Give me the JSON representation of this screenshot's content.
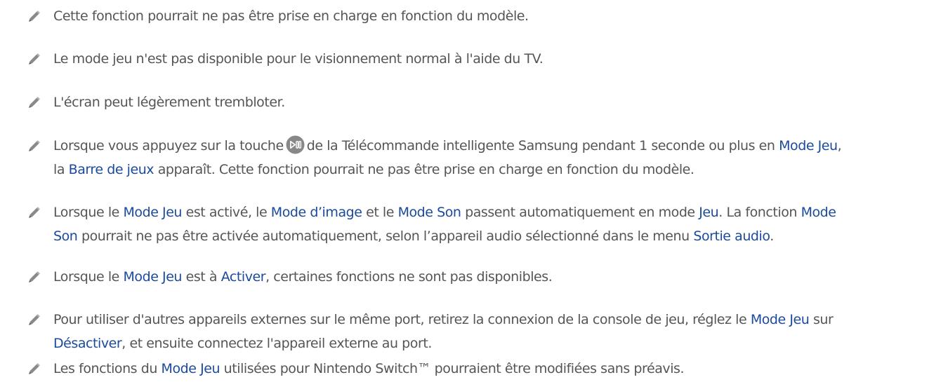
{
  "notes": [
    {
      "lines": [
        [
          {
            "t": "Cette fonction pourrait ne pas être prise en charge en fonction du modèle."
          }
        ]
      ]
    },
    {
      "lines": [
        [
          {
            "t": "Le mode jeu n'est pas disponible pour le visionnement normal à l'aide du TV."
          }
        ]
      ]
    },
    {
      "lines": [
        [
          {
            "t": "L'écran peut légèrement trembloter."
          }
        ]
      ]
    },
    {
      "lines": [
        [
          {
            "t": "Lorsque vous appuyez sur la touche"
          },
          {
            "icon": "play-pause-icon"
          },
          {
            "t": "de la Télécommande intelligente Samsung pendant 1 seconde ou plus en "
          },
          {
            "t": "Mode Jeu",
            "hl": true
          },
          {
            "t": ","
          }
        ],
        [
          {
            "t": "la "
          },
          {
            "t": "Barre de jeux",
            "hl": true
          },
          {
            "t": " apparaît. Cette fonction pourrait ne pas être prise en charge en fonction du modèle."
          }
        ]
      ]
    },
    {
      "lines": [
        [
          {
            "t": "Lorsque le "
          },
          {
            "t": "Mode Jeu",
            "hl": true
          },
          {
            "t": " est activé, le "
          },
          {
            "t": "Mode d’image",
            "hl": true
          },
          {
            "t": " et le "
          },
          {
            "t": "Mode Son",
            "hl": true
          },
          {
            "t": " passent automatiquement en mode "
          },
          {
            "t": "Jeu",
            "hl": true
          },
          {
            "t": ". La fonction "
          },
          {
            "t": "Mode",
            "hl": true
          }
        ],
        [
          {
            "t": "Son",
            "hl": true
          },
          {
            "t": " pourrait ne pas être activée automatiquement, selon l’appareil audio sélectionné dans le menu "
          },
          {
            "t": "Sortie audio",
            "hl": true
          },
          {
            "t": "."
          }
        ]
      ]
    },
    {
      "lines": [
        [
          {
            "t": "Lorsque le "
          },
          {
            "t": "Mode Jeu",
            "hl": true
          },
          {
            "t": " est à "
          },
          {
            "t": "Activer",
            "hl": true
          },
          {
            "t": ", certaines fonctions ne sont pas disponibles."
          }
        ]
      ]
    },
    {
      "lines": [
        [
          {
            "t": "Pour utiliser d'autres appareils externes sur le même port, retirez la connexion de la console de jeu, réglez le "
          },
          {
            "t": "Mode Jeu",
            "hl": true
          },
          {
            "t": " sur"
          }
        ],
        [
          {
            "t": "Désactiver",
            "hl": true
          },
          {
            "t": ", et ensuite connectez l'appareil externe au port."
          }
        ]
      ]
    },
    {
      "lines": [
        [
          {
            "t": "Les fonctions du "
          },
          {
            "t": "Mode Jeu",
            "hl": true
          },
          {
            "t": " utilisées pour Nintendo Switch™ pourraient être modifiées sans préavis."
          }
        ]
      ]
    }
  ],
  "colors": {
    "text": "#555555",
    "highlight": "#1a4a9c",
    "icon": "#888888"
  },
  "icons": {
    "note": "pencil-icon",
    "button": "play-pause-icon"
  }
}
